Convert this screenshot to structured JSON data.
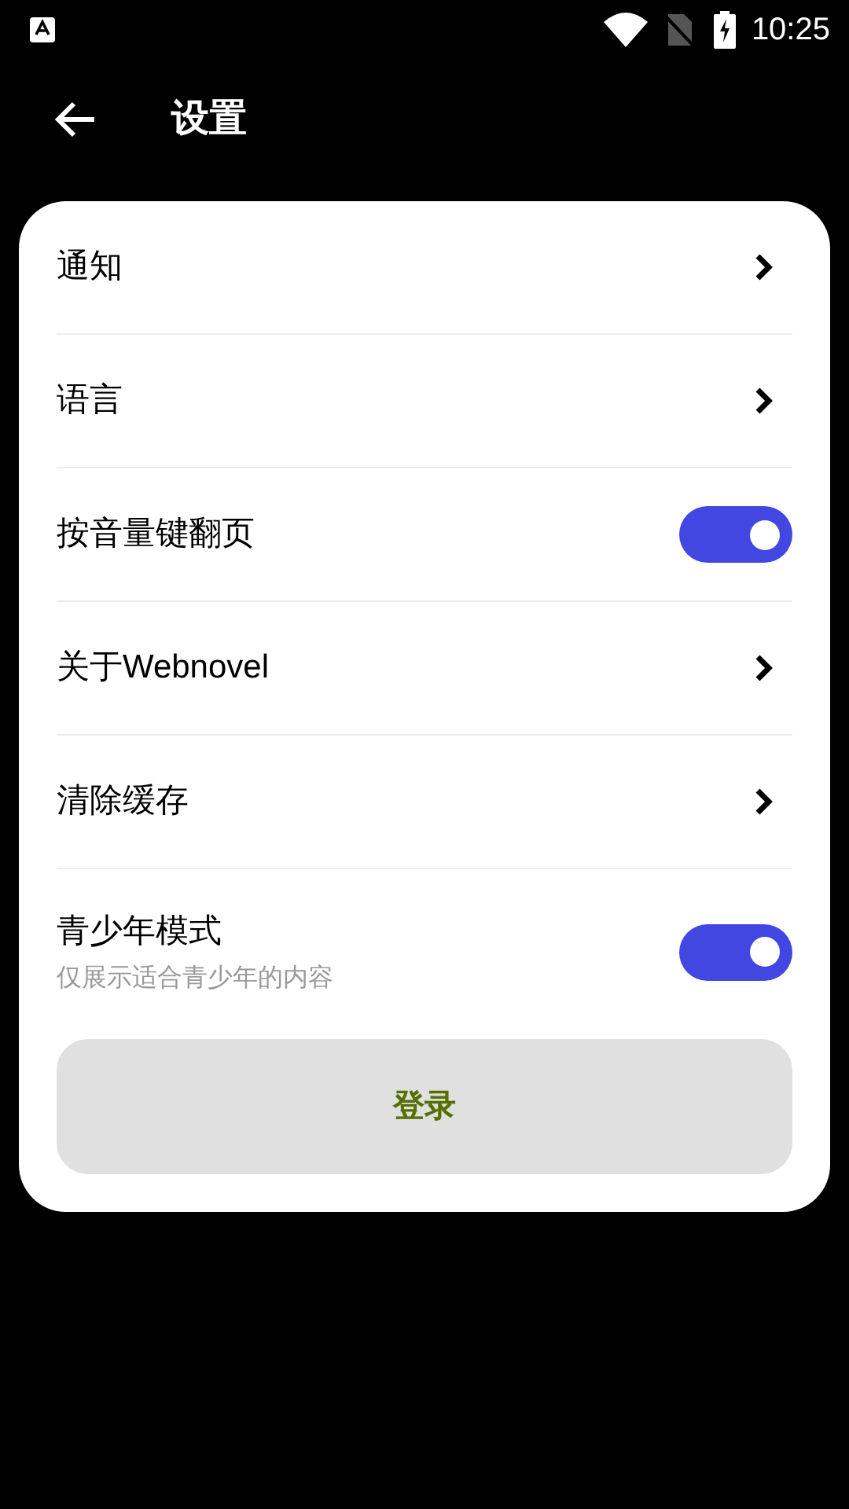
{
  "status_bar": {
    "time": "10:25"
  },
  "header": {
    "title": "设置"
  },
  "items": [
    {
      "kind": "link",
      "label": "通知"
    },
    {
      "kind": "link",
      "label": "语言"
    },
    {
      "kind": "toggle",
      "label": "按音量键翻页",
      "on": true
    },
    {
      "kind": "link",
      "label": "关于Webnovel"
    },
    {
      "kind": "link",
      "label": "清除缓存"
    },
    {
      "kind": "toggle",
      "label": "青少年模式",
      "subtitle": "仅展示适合青少年的内容",
      "on": true
    }
  ],
  "login_button": {
    "label": "登录"
  }
}
